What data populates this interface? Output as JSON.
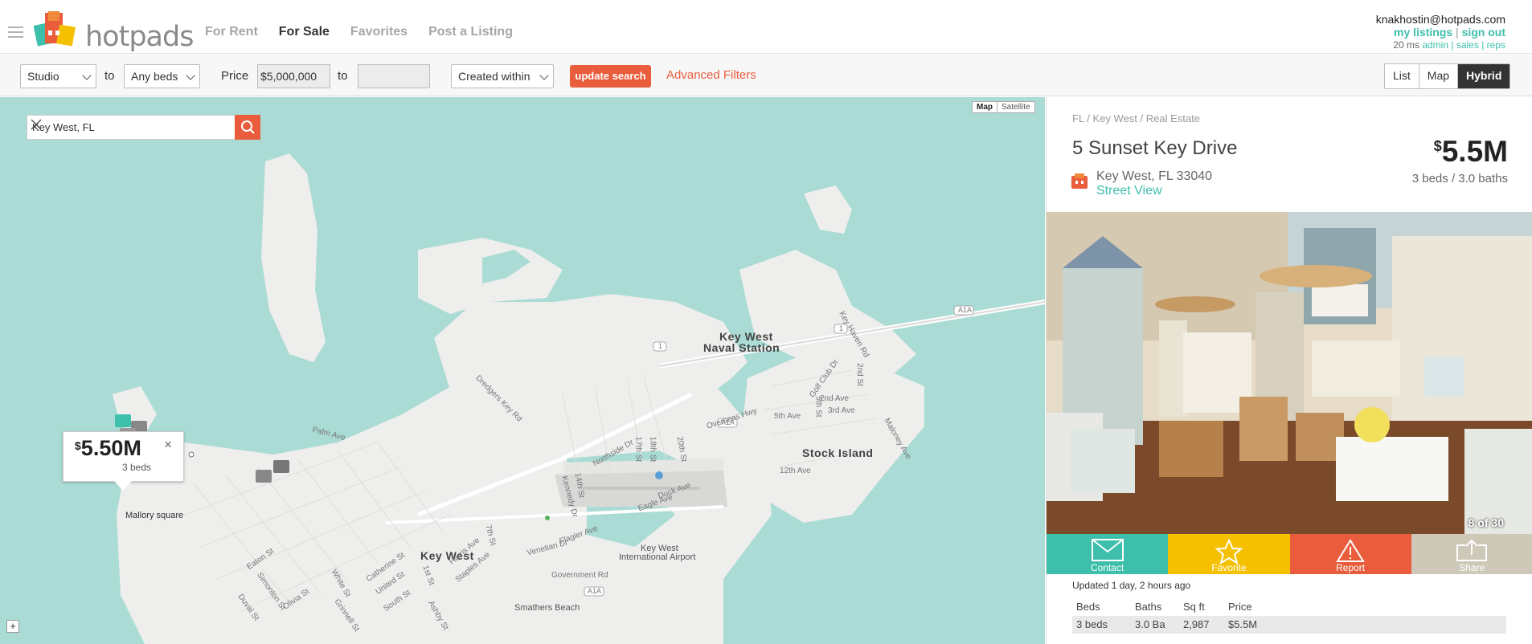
{
  "brand": {
    "name": "hotpads"
  },
  "nav": [
    "For Rent",
    "For Sale",
    "Favorites",
    "Post a Listing"
  ],
  "user": {
    "email": "knakhostin@hotpads.com",
    "my_listings": "my listings",
    "sign_out": "sign out",
    "sep": "|",
    "timing": "20 ms",
    "admin": "admin",
    "sales": "sales",
    "reps": "reps",
    "pipe": "|"
  },
  "filters": {
    "studio": "Studio",
    "to1": "to",
    "beds": "Any beds",
    "price_label": "Price",
    "price_min": "$5,000,000",
    "to2": "to",
    "price_max": "",
    "created": "Created within",
    "update": "update search",
    "advanced": "Advanced Filters"
  },
  "view_modes": [
    "List",
    "Map",
    "Hybrid"
  ],
  "map": {
    "type_map": "Map",
    "type_satellite": "Satellite",
    "search_value": "Key West, FL",
    "labels": {
      "naval1": "Key West",
      "naval2": "Naval Station",
      "stock": "Stock Island",
      "keywest": "Key West",
      "airport1": "Key West",
      "airport2": "International Airport",
      "mallory": "Mallory square",
      "smathers": "Smathers Beach",
      "palm": "Palm Ave",
      "overseas": "Overseas Hwy",
      "flagler": "Flagler Ave",
      "duck": "Duck Ave",
      "eagle": "Eagle Ave",
      "venetian": "Venetian Dr",
      "govt": "Government Rd",
      "a1a_1": "A1A",
      "a1a_2": "A1A",
      "a1a_3": "A1A",
      "r1a": "1",
      "r1b": "1",
      "s2nd": "2nd Ave",
      "s3rd": "3rd Ave",
      "s5th": "5th Ave",
      "s12th": "12th Ave",
      "s5st": "5th St",
      "s2st": "2nd St",
      "golf": "Golf Club Dr",
      "keyhaven": "Key Haven Rd",
      "maloney": "Maloney Ave",
      "dredgers": "Dredgers Key Rd",
      "northside": "Northside Dr",
      "s17": "17th St",
      "s18": "18th St",
      "s20": "20th St",
      "s14": "14th St",
      "kennedy": "Kennedy Dr",
      "s7": "7th St",
      "harris": "Harris Ave",
      "staples": "Staples Ave",
      "first": "1st St",
      "white": "White St",
      "catherine": "Catherine St",
      "united": "United St",
      "south": "South St",
      "olivia": "Olivia St",
      "simonton": "Simonton St",
      "duval": "Duval St",
      "eaton": "Eaton St",
      "ashby": "Ashby St",
      "grinnell": "Grinnell St"
    },
    "popup": {
      "currency": "$",
      "price": "5.50M",
      "beds": "3 beds",
      "close": "×"
    },
    "zoom": "+"
  },
  "listing": {
    "breadcrumb": "FL / Key West / Real Estate",
    "address": "5 Sunset Key Drive",
    "currency": "$",
    "price": "5.5M",
    "beds_baths": "3 beds / 3.0 baths",
    "city": "Key West, FL 33040",
    "street_view": "Street View",
    "photo_counter": "8 of 30",
    "actions": [
      "Contact",
      "Favorite",
      "Report",
      "Share"
    ],
    "updated": "Updated 1 day, 2 hours ago",
    "facts_headers": [
      "Beds",
      "Baths",
      "Sq ft",
      "Price"
    ],
    "facts_values": [
      "3 beds",
      "3.0 Ba",
      "2,987",
      "$5.5M"
    ]
  },
  "colors": {
    "accent_teal": "#3dbfab",
    "accent_orange": "#e95c3c",
    "accent_yellow": "#f5c000",
    "map_water": "#aadbd4"
  }
}
